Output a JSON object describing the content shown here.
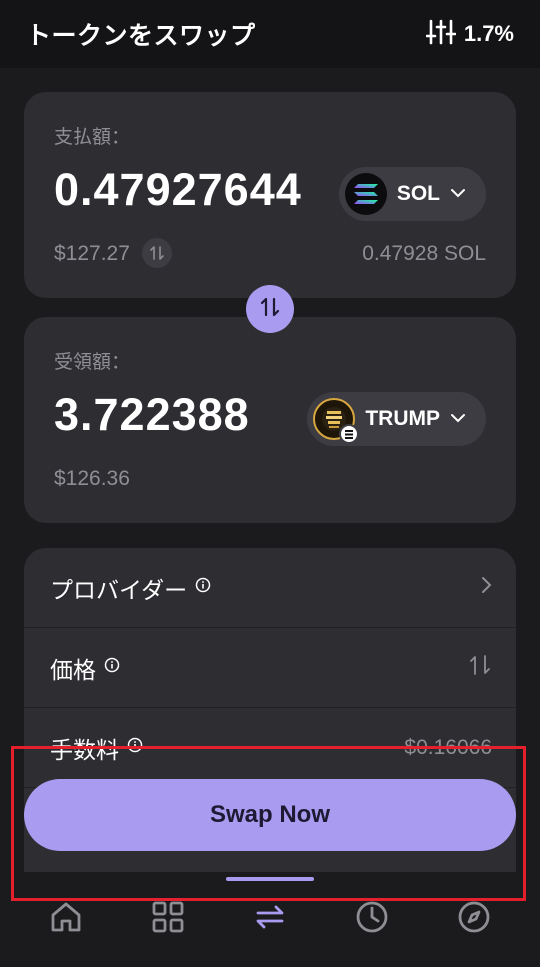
{
  "header": {
    "title": "トークンをスワップ",
    "slippage": "1.7%",
    "slippage_icon": "sliders-icon"
  },
  "pay": {
    "label": "支払額：",
    "amount": "0.47927644",
    "usd_value": "$127.27",
    "token": {
      "symbol": "SOL",
      "icon": "solana-logo"
    },
    "balance": "0.47928 SOL"
  },
  "receive": {
    "label": "受領額：",
    "amount": "3.722388",
    "usd_value": "$126.36",
    "token": {
      "symbol": "TRUMP",
      "icon": "trump-logo"
    }
  },
  "details": {
    "provider_label": "プロバイダー",
    "price_label": "価格",
    "fee_label": "手数料",
    "fee_value": "$0.16066"
  },
  "actions": {
    "swap_now": "Swap Now"
  },
  "nav": {
    "items": [
      {
        "icon": "home-icon",
        "active": false
      },
      {
        "icon": "grid-icon",
        "active": false
      },
      {
        "icon": "swap-icon",
        "active": true
      },
      {
        "icon": "clock-icon",
        "active": false
      },
      {
        "icon": "compass-icon",
        "active": false
      }
    ]
  },
  "colors": {
    "accent": "#a99cf0",
    "background": "#1b1b1d",
    "card": "#2d2d32",
    "highlight": "#e3202b"
  }
}
